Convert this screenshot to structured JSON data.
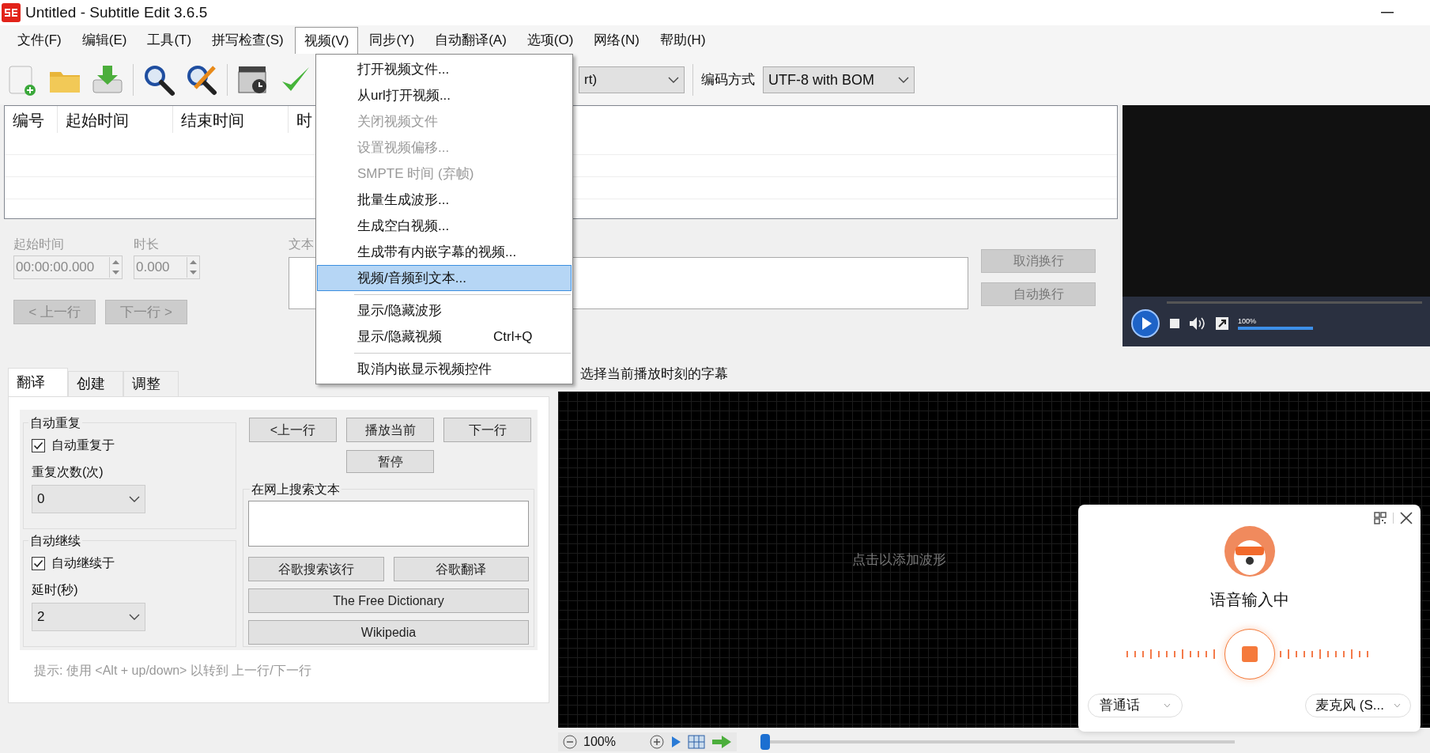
{
  "window": {
    "title": "Untitled - Subtitle Edit 3.6.5"
  },
  "menu_bar": [
    {
      "label": "文件(F)",
      "selected": false
    },
    {
      "label": "编辑(E)",
      "selected": false
    },
    {
      "label": "工具(T)",
      "selected": false
    },
    {
      "label": "拼写检查(S)",
      "selected": false
    },
    {
      "label": "视频(V)",
      "selected": true
    },
    {
      "label": "同步(Y)",
      "selected": false
    },
    {
      "label": "自动翻译(A)",
      "selected": false
    },
    {
      "label": "选项(O)",
      "selected": false
    },
    {
      "label": "网络(N)",
      "selected": false
    },
    {
      "label": "帮助(H)",
      "selected": false
    }
  ],
  "video_menu": [
    {
      "kind": "item",
      "label": "打开视频文件...",
      "disabled": false,
      "selected": false
    },
    {
      "kind": "item",
      "label": "从url打开视频...",
      "disabled": false,
      "selected": false
    },
    {
      "kind": "item",
      "label": "关闭视频文件",
      "disabled": true,
      "selected": false
    },
    {
      "kind": "item",
      "label": "设置视频偏移...",
      "disabled": true,
      "selected": false
    },
    {
      "kind": "item",
      "label": "SMPTE 时间 (弃帧)",
      "disabled": true,
      "selected": false
    },
    {
      "kind": "item",
      "label": "批量生成波形...",
      "disabled": false,
      "selected": false
    },
    {
      "kind": "item",
      "label": "生成空白视频...",
      "disabled": false,
      "selected": false
    },
    {
      "kind": "item",
      "label": "生成带有内嵌字幕的视频...",
      "disabled": false,
      "selected": false
    },
    {
      "kind": "item",
      "label": "视频/音频到文本...",
      "disabled": false,
      "selected": true
    },
    {
      "kind": "separator"
    },
    {
      "kind": "item",
      "label": "显示/隐藏波形",
      "disabled": false,
      "selected": false
    },
    {
      "kind": "item",
      "label": "显示/隐藏视频",
      "shortcut": "Ctrl+Q",
      "disabled": false,
      "selected": false
    },
    {
      "kind": "separator"
    },
    {
      "kind": "item",
      "label": "取消内嵌显示视频控件",
      "disabled": false,
      "selected": false
    }
  ],
  "toolbar": {
    "format_value": "rt)",
    "encoding_label": "编码方式",
    "encoding_value": "UTF-8 with BOM"
  },
  "subtitle_table": {
    "columns": [
      "编号",
      "起始时间",
      "结束时间",
      "时"
    ]
  },
  "edit_panel": {
    "start_label": "起始时间",
    "start_value": "00:00:00.000",
    "duration_label": "时长",
    "duration_value": "0.000",
    "text_label": "文本",
    "prev_button": "< 上一行",
    "next_button": "下一行 >",
    "unbreak_button": "取消换行",
    "auto_break_button": "自动换行"
  },
  "video_player": {
    "volume": {
      "reading": "100%",
      "level": 1
    }
  },
  "tabs": [
    {
      "label": "翻译",
      "selected": true
    },
    {
      "label": "创建",
      "selected": false
    },
    {
      "label": "调整",
      "selected": false
    }
  ],
  "translate_tab": {
    "auto_repeat": {
      "title": "自动重复",
      "checkbox_label": "自动重复于",
      "checked": true,
      "count_label": "重复次数(次)",
      "count_value": "0"
    },
    "auto_continue": {
      "title": "自动继续",
      "checkbox_label": "自动继续于",
      "checked": true,
      "delay_label": "延时(秒)",
      "delay_value": "2"
    },
    "prev_button": "<上一行",
    "play_button": "播放当前",
    "next_button": "下一行",
    "pause_button": "暂停",
    "search": {
      "title": "在网上搜索文本",
      "google_search_button": "谷歌搜索该行",
      "google_translate_button": "谷歌翻译",
      "dictionary_button": "The Free Dictionary",
      "wikipedia_button": "Wikipedia"
    },
    "hint": "提示: 使用 <Alt + up/down> 以转到 上一行/下一行"
  },
  "waveform": {
    "select_current_label": "选择当前播放时刻的字幕",
    "placeholder": "点击以添加波形",
    "zoom_value": "100%",
    "position": {
      "level": 0
    }
  },
  "voice_popup": {
    "status": "语音输入中",
    "language": "普通话",
    "microphone": "麦克风 (S..."
  }
}
